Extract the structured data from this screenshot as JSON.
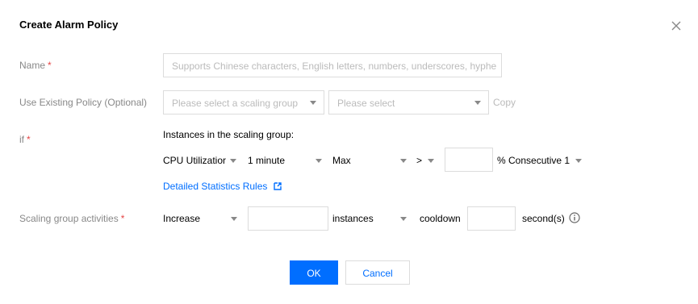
{
  "dialog": {
    "title": "Create Alarm Policy",
    "close_icon": "close-icon"
  },
  "name_row": {
    "label": "Name",
    "required": "*",
    "placeholder": "Supports Chinese characters, English letters, numbers, underscores, hyphe"
  },
  "existing_policy_row": {
    "label": "Use Existing Policy (Optional)",
    "group_select_placeholder": "Please select a scaling group",
    "policy_select_placeholder": "Please select",
    "copy_label": "Copy"
  },
  "if_row": {
    "label": "if",
    "required": "*",
    "heading": "Instances in the scaling group:",
    "metric": "CPU Utilizatior",
    "period": "1 minute",
    "statistic": "Max",
    "operator": ">",
    "threshold_value": "",
    "unit_prefix": "% Consecutive 1",
    "details_link": "Detailed Statistics Rules",
    "external_link_icon": "external-link-icon"
  },
  "activities_row": {
    "label": "Scaling group activities",
    "required": "*",
    "action": "Increase",
    "count_value": "",
    "unit": "instances",
    "cooldown_label": "cooldown",
    "cooldown_value": "",
    "seconds_label": "second(s)",
    "info_icon": "info-icon"
  },
  "footer": {
    "ok_label": "OK",
    "cancel_label": "Cancel"
  },
  "colors": {
    "primary": "#006eff",
    "required": "#e54545",
    "label": "#888888",
    "placeholder": "#bbbbbb",
    "border": "#dcdcdc"
  }
}
